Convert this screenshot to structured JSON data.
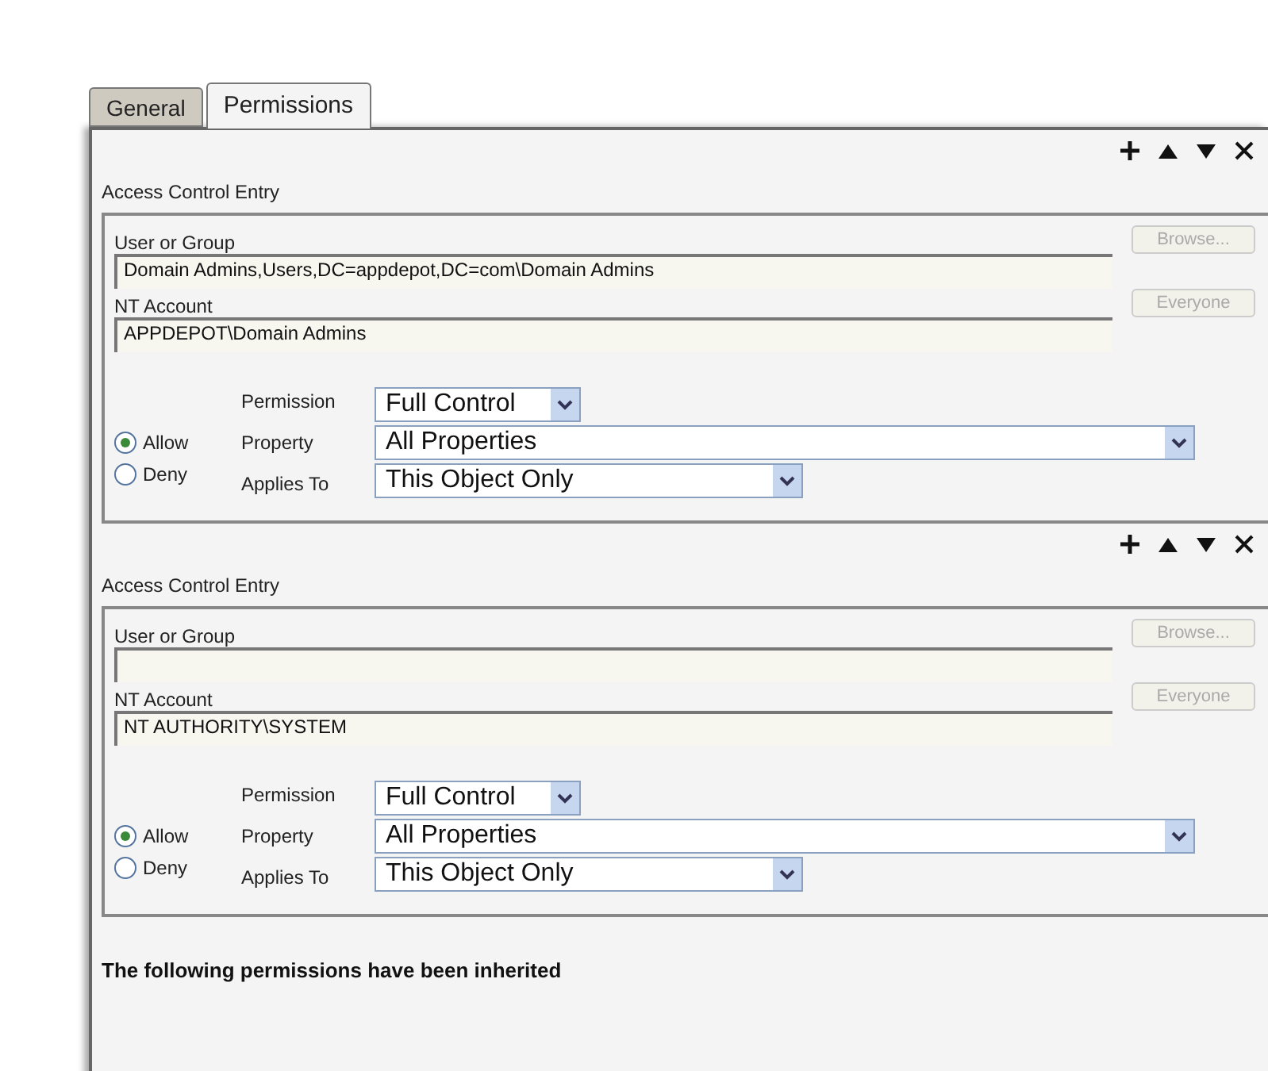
{
  "tabs": [
    {
      "label": "General",
      "selected": false
    },
    {
      "label": "Permissions",
      "selected": true
    }
  ],
  "entries": [
    {
      "title": "Access Control Entry",
      "user_label": "User or Group",
      "user_value": "Domain Admins,Users,DC=appdepot,DC=com\\Domain Admins",
      "browse": {
        "label": "Browse...",
        "disabled": true
      },
      "account_label": "NT Account",
      "account_value": "APPDEPOT\\Domain Admins",
      "everyone": {
        "label": "Everyone",
        "disabled": true
      },
      "access": [
        {
          "label": "Allow",
          "selected": true
        },
        {
          "label": "Deny",
          "selected": false
        }
      ],
      "permission_label": "Permission",
      "permission": "Full Control",
      "property_label": "Property",
      "property": "All Properties",
      "applies_label": "Applies To",
      "applies": "This Object Only"
    },
    {
      "title": "Access Control Entry",
      "user_label": "User or Group",
      "browse": {
        "label": "Browse...",
        "disabled": true
      },
      "account_label": "NT Account",
      "account_value": "NT AUTHORITY\\SYSTEM",
      "everyone": {
        "label": "Everyone",
        "disabled": true
      },
      "access": [
        {
          "label": "Allow",
          "selected": true
        },
        {
          "label": "Deny",
          "selected": false
        }
      ],
      "permission_label": "Permission",
      "permission": "Full Control",
      "property_label": "Property",
      "property": "All Properties",
      "applies_label": "Applies To",
      "applies": "This Object Only"
    }
  ],
  "inherited_heading": "The following permissions have been inherited"
}
